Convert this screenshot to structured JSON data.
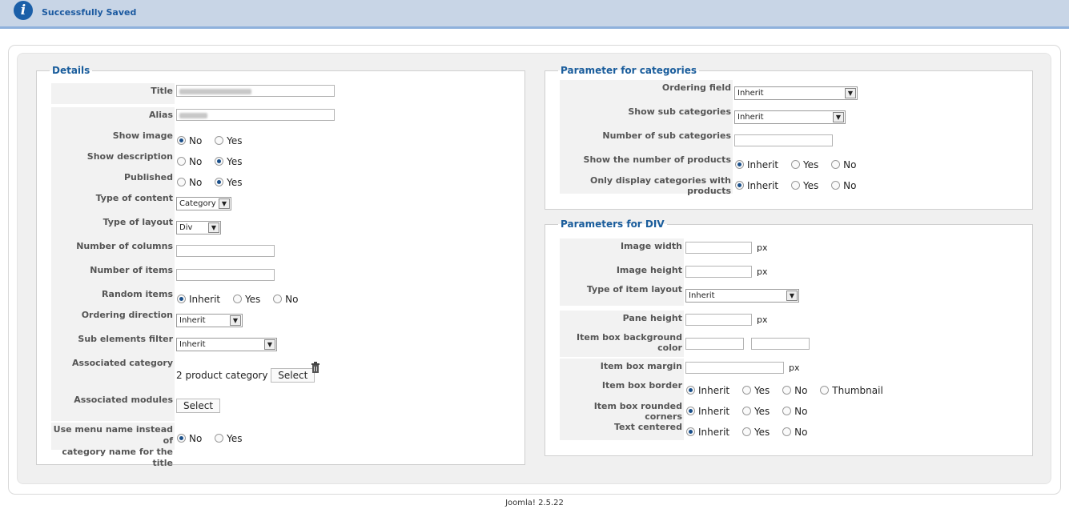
{
  "message": "Successfully Saved",
  "details": {
    "legend": "Details",
    "title_label": "Title",
    "alias_label": "Alias",
    "show_image": {
      "label": "Show image",
      "options": [
        "No",
        "Yes"
      ]
    },
    "show_description": {
      "label": "Show description",
      "options": [
        "No",
        "Yes"
      ]
    },
    "published": {
      "label": "Published",
      "options": [
        "No",
        "Yes"
      ]
    },
    "type_of_content": {
      "label": "Type of content",
      "value": "Category"
    },
    "type_of_layout": {
      "label": "Type of layout",
      "value": "Div"
    },
    "number_of_columns": {
      "label": "Number of columns"
    },
    "number_of_items": {
      "label": "Number of items"
    },
    "random_items": {
      "label": "Random items",
      "options": [
        "Inherit",
        "Yes",
        "No"
      ]
    },
    "ordering_direction": {
      "label": "Ordering direction",
      "value": "Inherit"
    },
    "sub_elements_filter": {
      "label": "Sub elements filter",
      "value": "Inherit"
    },
    "associated_category": {
      "label": "Associated category",
      "text": "2 product category",
      "button": "Select"
    },
    "associated_modules": {
      "label": "Associated modules",
      "button": "Select"
    },
    "use_menu_name": {
      "label_line1": "Use menu name instead of",
      "label_line2": "category name for the title",
      "options": [
        "No",
        "Yes"
      ]
    }
  },
  "categories": {
    "legend": "Parameter for categories",
    "ordering_field": {
      "label": "Ordering field",
      "value": "Inherit"
    },
    "show_sub_categories": {
      "label": "Show sub categories",
      "value": "Inherit"
    },
    "number_of_sub_categories": {
      "label": "Number of sub categories"
    },
    "show_number_products": {
      "label": "Show the number of products",
      "options": [
        "Inherit",
        "Yes",
        "No"
      ]
    },
    "only_display": {
      "label": "Only display categories with products",
      "options": [
        "Inherit",
        "Yes",
        "No"
      ]
    }
  },
  "div": {
    "legend": "Parameters for DIV",
    "image_width": {
      "label": "Image width",
      "unit": "px"
    },
    "image_height": {
      "label": "Image height",
      "unit": "px"
    },
    "type_item_layout": {
      "label": "Type of item layout",
      "value": "Inherit"
    },
    "pane_height": {
      "label": "Pane height",
      "unit": "px"
    },
    "item_box_bg": {
      "label": "Item box background color"
    },
    "item_box_margin": {
      "label": "Item box margin",
      "unit": "px"
    },
    "item_box_border": {
      "label": "Item box border",
      "options": [
        "Inherit",
        "Yes",
        "No",
        "Thumbnail"
      ]
    },
    "item_box_rounded": {
      "label": "Item box rounded corners",
      "options": [
        "Inherit",
        "Yes",
        "No"
      ]
    },
    "text_centered": {
      "label": "Text centered",
      "options": [
        "Inherit",
        "Yes",
        "No"
      ]
    }
  },
  "footer": "Joomla! 2.5.22",
  "icons": {
    "message": "info-icon",
    "associated_category_delete": "trash-icon"
  },
  "colors": {
    "accent": "#1a5d9c",
    "message_bar": "#c8d5e6"
  }
}
